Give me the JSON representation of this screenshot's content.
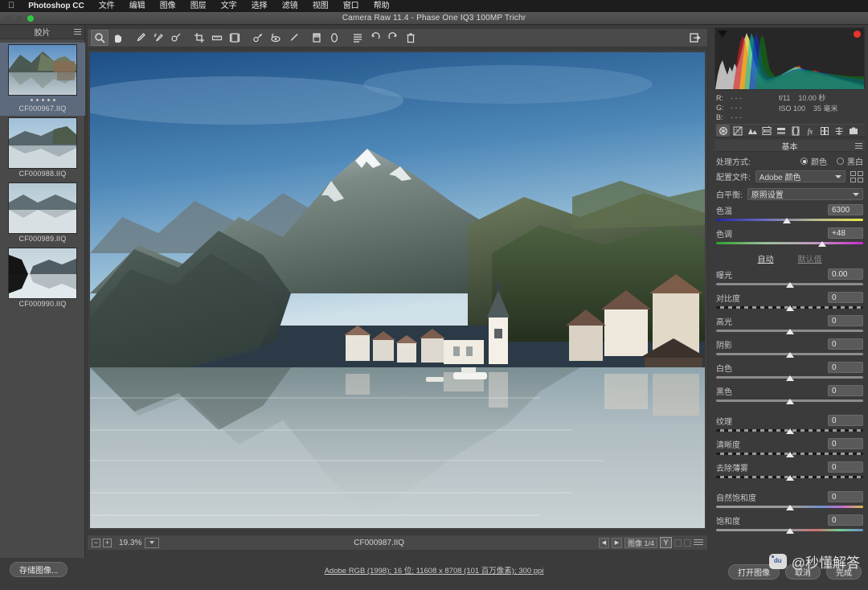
{
  "menubar": {
    "apple_icon": "apple-icon",
    "app_name": "Photoshop CC",
    "items": [
      "文件",
      "编辑",
      "图像",
      "图层",
      "文字",
      "选择",
      "滤镜",
      "视图",
      "窗口",
      "帮助"
    ]
  },
  "titlebar": {
    "title": "Camera Raw 11.4 -  Phase One IQ3 100MP Trichr"
  },
  "filmstrip": {
    "header": "胶片",
    "items": [
      {
        "name": "CF000967.IIQ",
        "rating": 5,
        "selected": true
      },
      {
        "name": "CF000988.IIQ",
        "rating": 0,
        "selected": false
      },
      {
        "name": "CF000989.IIQ",
        "rating": 0,
        "selected": false
      },
      {
        "name": "CF000990.IIQ",
        "rating": 0,
        "selected": false
      }
    ]
  },
  "toolbar": {
    "tools": [
      {
        "name": "zoom-tool",
        "active": true
      },
      {
        "name": "hand-tool",
        "active": false
      },
      {
        "name": "white-balance-tool",
        "active": false
      },
      {
        "name": "color-sampler-tool",
        "active": false
      },
      {
        "name": "targeted-adjustment-tool",
        "active": false
      },
      {
        "name": "crop-tool",
        "active": false
      },
      {
        "name": "straighten-tool",
        "active": false
      },
      {
        "name": "transform-tool",
        "active": false
      },
      {
        "name": "spot-removal-tool",
        "active": false
      },
      {
        "name": "red-eye-tool",
        "active": false
      },
      {
        "name": "adjustment-brush-tool",
        "active": false
      },
      {
        "name": "graduated-filter-tool",
        "active": false
      },
      {
        "name": "radial-filter-tool",
        "active": false
      },
      {
        "name": "preferences-tool",
        "active": false
      },
      {
        "name": "rotate-ccw-tool",
        "active": false
      },
      {
        "name": "rotate-cw-tool",
        "active": false
      },
      {
        "name": "delete-tool",
        "active": false
      }
    ],
    "fullscreen_toggle": "fullscreen-icon"
  },
  "statusbar": {
    "zoom_out": "−",
    "zoom_in": "+",
    "zoom_level": "19.3%",
    "filename": "CF000987.IIQ",
    "prev": "◀",
    "next": "▶",
    "image_count": "图像 1/4",
    "sync_label": "Y"
  },
  "histogram": {
    "shadow_clip_icon": "shadow-clipping-icon",
    "highlight_clip_icon": "highlight-clipping-icon"
  },
  "exif": {
    "r_label": "R:",
    "r_value": "- - -",
    "g_label": "G:",
    "g_value": "- - -",
    "b_label": "B:",
    "b_value": "- - -",
    "aperture": "f/11",
    "shutter": "10.00 秒",
    "iso": "ISO 100",
    "focal": "35 毫米"
  },
  "panel_tabs": [
    {
      "name": "basic-tab",
      "icon": "aperture-icon",
      "active": true
    },
    {
      "name": "tone-curve-tab",
      "icon": "curve-icon",
      "active": false
    },
    {
      "name": "detail-tab",
      "icon": "triangles-icon",
      "active": false
    },
    {
      "name": "hsl-tab",
      "icon": "hsl-icon",
      "active": false
    },
    {
      "name": "split-toning-tab",
      "icon": "split-toning-icon",
      "active": false
    },
    {
      "name": "lens-correction-tab",
      "icon": "lens-icon",
      "active": false
    },
    {
      "name": "effects-tab",
      "icon": "fx-icon",
      "active": false
    },
    {
      "name": "calibration-tab",
      "icon": "calibration-icon",
      "active": false
    },
    {
      "name": "presets-tab",
      "icon": "presets-icon",
      "active": false
    },
    {
      "name": "snapshots-tab",
      "icon": "snapshots-icon",
      "active": false
    }
  ],
  "basic_panel": {
    "title": "基本",
    "treatment": {
      "label": "处理方式:",
      "options": [
        {
          "label": "颜色",
          "selected": true
        },
        {
          "label": "黑白",
          "selected": false
        }
      ]
    },
    "profile": {
      "label": "配置文件:",
      "value": "Adobe 颜色"
    },
    "white_balance": {
      "label": "白平衡:",
      "value": "原照设置"
    },
    "temperature": {
      "label": "色温",
      "value": "6300",
      "knob_pct": 48
    },
    "tint": {
      "label": "色调",
      "value": "+48",
      "knob_pct": 72
    },
    "auto_link": "自动",
    "default_link": "默认值",
    "sliders": [
      {
        "label": "曝光",
        "value": "0.00",
        "knob_pct": 50,
        "style": "plain"
      },
      {
        "label": "对比度",
        "value": "0",
        "knob_pct": 50,
        "style": "dash"
      },
      {
        "label": "高光",
        "value": "0",
        "knob_pct": 50,
        "style": "plain"
      },
      {
        "label": "阴影",
        "value": "0",
        "knob_pct": 50,
        "style": "plain"
      },
      {
        "label": "白色",
        "value": "0",
        "knob_pct": 50,
        "style": "plain"
      },
      {
        "label": "黑色",
        "value": "0",
        "knob_pct": 50,
        "style": "plain"
      }
    ],
    "sliders2": [
      {
        "label": "纹理",
        "value": "0",
        "knob_pct": 50,
        "style": "dash"
      },
      {
        "label": "清晰度",
        "value": "0",
        "knob_pct": 50,
        "style": "dash"
      },
      {
        "label": "去除薄雾",
        "value": "0",
        "knob_pct": 50,
        "style": "dash"
      }
    ],
    "sliders3": [
      {
        "label": "自然饱和度",
        "value": "0",
        "knob_pct": 50,
        "style": "vib"
      },
      {
        "label": "饱和度",
        "value": "0",
        "knob_pct": 50,
        "style": "sat"
      }
    ]
  },
  "bottombar": {
    "save_image": "存储图像...",
    "workflow": "Adobe RGB (1998); 16 位;  11608 x 8708 (101 百万像素); 300 ppi",
    "open_image": "打开图像",
    "cancel": "取消",
    "done": "完成"
  },
  "watermark": {
    "text": "@秒懂解答",
    "logo": "baidu-logo-icon"
  },
  "colors": {
    "panel_bg": "#3b3b3b",
    "accent_selection": "#5d6a7d",
    "clip_red": "#e8352b",
    "green_light": "#2ecc41"
  }
}
